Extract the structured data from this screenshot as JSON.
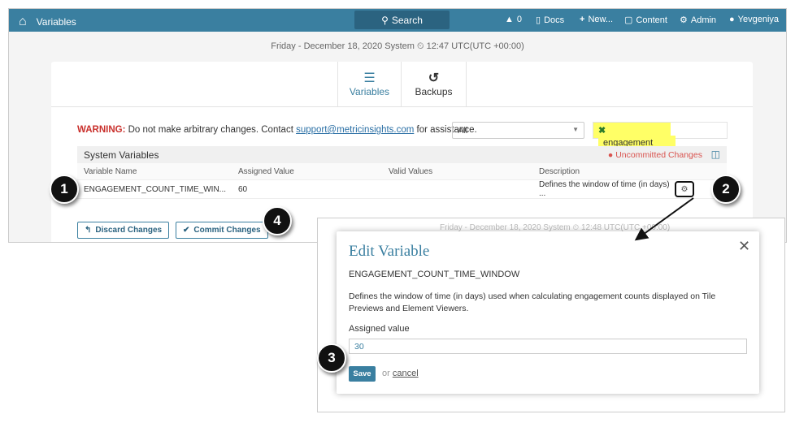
{
  "header": {
    "title": "Variables",
    "search": "Search",
    "alerts": "0",
    "docs": "Docs",
    "new": "New...",
    "content": "Content",
    "admin": "Admin",
    "user": "Yevgeniya"
  },
  "date_line": "Friday - December 18, 2020 System ⏲ 12:47 UTC(UTC +00:00)",
  "tabs": [
    {
      "label": "Variables"
    },
    {
      "label": "Backups"
    }
  ],
  "warning": {
    "label": "WARNING:",
    "text": " Do not make arbitrary changes. Contact ",
    "email": "support@metricinsights.com",
    "tail": " for assistance."
  },
  "filter": {
    "select": "All",
    "search": "engagement"
  },
  "table": {
    "title": "System Variables",
    "status": "Uncommitted Changes",
    "columns": [
      "Variable Name",
      "Assigned Value",
      "Valid Values",
      "Description"
    ],
    "rows": [
      [
        "ENGAGEMENT_COUNT_TIME_WIN...",
        "60",
        "",
        "Defines the window of time (in days) ..."
      ]
    ]
  },
  "buttons": {
    "discard": "Discard Changes",
    "commit": "Commit Changes"
  },
  "modal": {
    "title": "Edit Variable",
    "name": "ENGAGEMENT_COUNT_TIME_WINDOW",
    "description": "Defines the window of time (in days) used when calculating engagement counts displayed on Tile Previews and Element Viewers.",
    "assigned_label": "Assigned value",
    "assigned_value": "30",
    "save": "Save",
    "or": "or ",
    "cancel": "cancel"
  },
  "background_date": "Friday - December 18, 2020 System ⏲ 12:48 UTC(UTC +00:00)",
  "callouts": [
    "1",
    "2",
    "3",
    "4"
  ],
  "colors": {
    "brand": "#3a7fa0",
    "warning": "#c9302c",
    "highlight": "#ffff66"
  }
}
